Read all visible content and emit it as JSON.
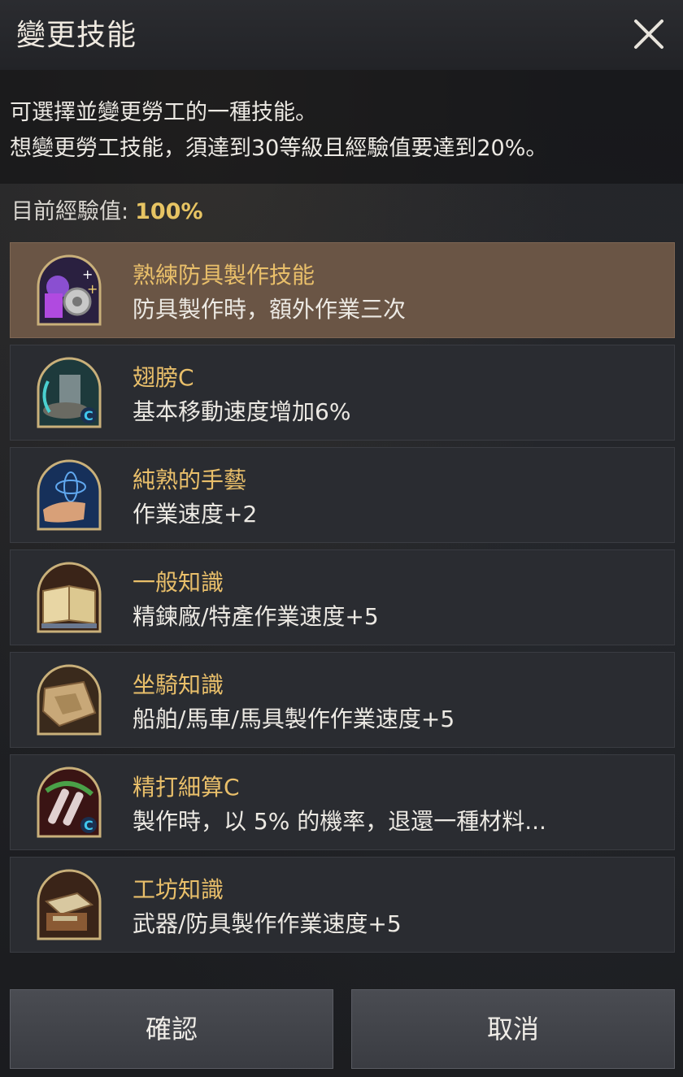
{
  "dialog": {
    "title": "變更技能",
    "description_lines": [
      "可選擇並變更勞工的一種技能。",
      "想變更勞工技能，須達到30等級且經驗值要達到20%。"
    ],
    "experience_label": "目前經驗值:",
    "experience_value": "100%"
  },
  "skills": [
    {
      "name": "熟練防具製作技能",
      "effect": "防具製作時，額外作業三次",
      "icon": "armor-crafting-icon",
      "selected": true
    },
    {
      "name": "翅膀C",
      "effect": "基本移動速度增加6%",
      "icon": "wings-icon",
      "selected": false
    },
    {
      "name": "純熟的手藝",
      "effect": "作業速度+2",
      "icon": "craftsmanship-icon",
      "selected": false
    },
    {
      "name": "一般知識",
      "effect": "精鍊廠/特產作業速度+5",
      "icon": "book-icon",
      "selected": false
    },
    {
      "name": "坐騎知識",
      "effect": "船舶/馬車/馬具製作作業速度+5",
      "icon": "mount-map-icon",
      "selected": false
    },
    {
      "name": "精打細算C",
      "effect": "製作時，以 5% 的機率，退還一種材料...",
      "icon": "potion-icon",
      "selected": false
    },
    {
      "name": "工坊知識",
      "effect": "武器/防具製作作業速度+5",
      "icon": "workshop-icon",
      "selected": false
    }
  ],
  "buttons": {
    "confirm": "確認",
    "cancel": "取消"
  },
  "colors": {
    "accent_name": "#e9bf6a",
    "exp_value": "#e7c463",
    "selected_row": "#6a5545"
  }
}
